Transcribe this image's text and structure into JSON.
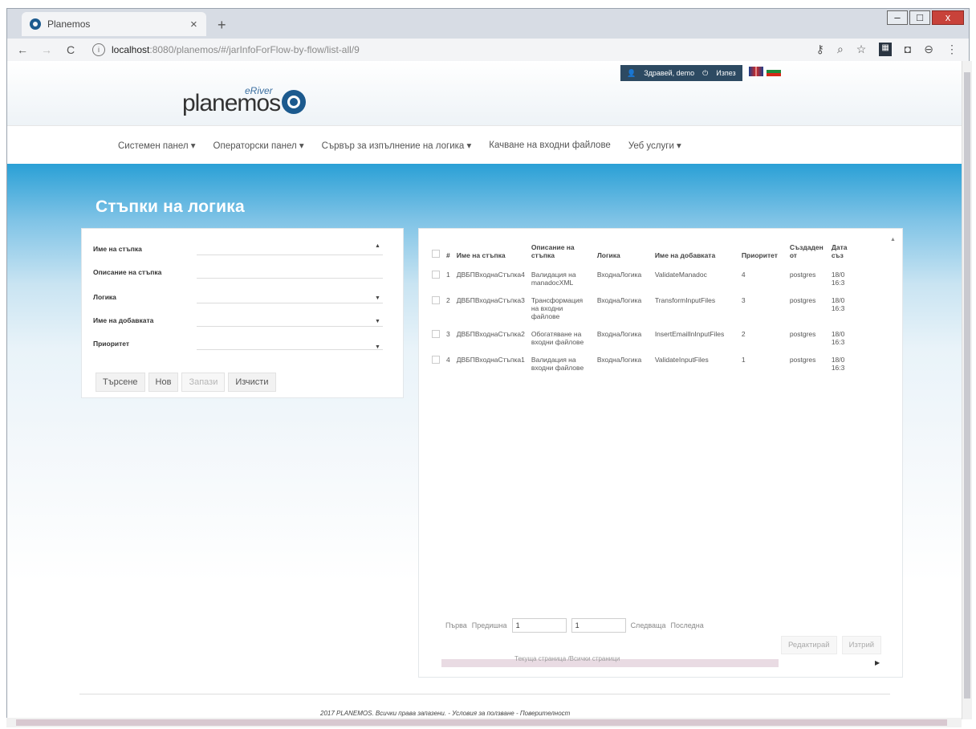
{
  "browser": {
    "tab_title": "Planemos",
    "tab_close": "×",
    "new_tab": "+",
    "url_host": "localhost",
    "url_path": ":8080/planemos/#/jarInfoForFlow-by-flow/list-all/9",
    "win_min": "–",
    "win_max": "□",
    "win_close": "x"
  },
  "header": {
    "greeting": "Здравей, demo",
    "logout": "Изпез",
    "logo_text": "planemos",
    "logo_sub": "eRiver"
  },
  "nav": {
    "items": [
      {
        "label": "Системен панел ▾"
      },
      {
        "label": "Операторски панел ▾"
      },
      {
        "label": "Сървър за изпълнение на логика ▾"
      },
      {
        "label": "Качване на входни файлове"
      },
      {
        "label": "Уеб услуги ▾"
      }
    ]
  },
  "page_title": "Стъпки на логика",
  "filters": {
    "step_name_label": "Име на стъпка",
    "step_desc_label": "Описание на стъпка",
    "logic_label": "Логика",
    "addon_label": "Име на добавката",
    "priority_label": "Приоритет"
  },
  "buttons": {
    "search": "Търсене",
    "new": "Нов",
    "save": "Запази",
    "clear": "Изчисти"
  },
  "table": {
    "headers": [
      "#",
      "Име на стъпка",
      "Описание на стъпка",
      "Логика",
      "Име на добавката",
      "Приоритет",
      "Създаден от",
      "Дата съз"
    ],
    "rows": [
      {
        "num": "1",
        "name": "ДВБПВходнаСтъпка4",
        "desc": "Валидация на manadocXML",
        "logic": "ВходнаЛогика",
        "addon": "ValidateManadoc",
        "priority": "4",
        "created_by": "postgres",
        "date": "18/0 16:3"
      },
      {
        "num": "2",
        "name": "ДВБПВходнаСтъпка3",
        "desc": "Трансформация на входни файлове",
        "logic": "ВходнаЛогика",
        "addon": "TransformInputFiles",
        "priority": "3",
        "created_by": "postgres",
        "date": "18/0 16:3"
      },
      {
        "num": "3",
        "name": "ДВБПВходнаСтъпка2",
        "desc": "Обогатяване на входни файлове",
        "logic": "ВходнаЛогика",
        "addon": "InsertEmailInInputFiles",
        "priority": "2",
        "created_by": "postgres",
        "date": "18/0 16:3"
      },
      {
        "num": "4",
        "name": "ДВБПВходнаСтъпка1",
        "desc": "Валидация на входни файлове",
        "logic": "ВходнаЛогика",
        "addon": "ValidateInputFiles",
        "priority": "1",
        "created_by": "postgres",
        "date": "18/0 16:3"
      }
    ]
  },
  "pagination": {
    "first": "Първа",
    "prev": "Предишна",
    "current_page": "1",
    "total_pages": "1",
    "next": "Следваща",
    "last": "Последна",
    "info": "Текуща страница /Всички страници"
  },
  "actions": {
    "edit": "Редактирай",
    "delete": "Изтрий"
  },
  "footer": {
    "text": "2017 PLANEMOS. Всички права запазени. - Условия за ползване - Поверителност"
  }
}
